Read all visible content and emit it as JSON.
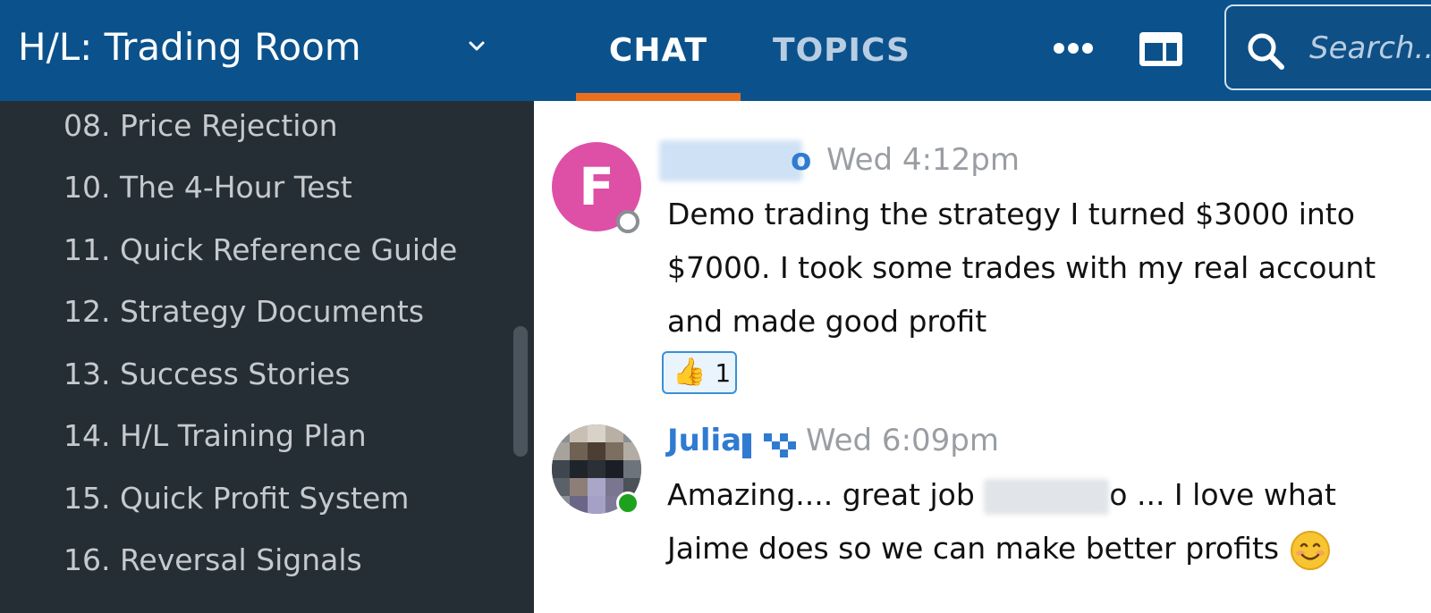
{
  "header": {
    "room_title": "H/L: Trading Room",
    "tabs": [
      {
        "label": "CHAT",
        "active": true
      },
      {
        "label": "TOPICS",
        "active": false
      }
    ],
    "search_placeholder": "Search...",
    "colors": {
      "background": "#0b528c",
      "active_underline": "#e8701f"
    },
    "icons": [
      "chevron-down-icon",
      "more-icon",
      "layout-icon",
      "search-icon"
    ]
  },
  "sidebar": {
    "items": [
      {
        "label": "08. Price Rejection"
      },
      {
        "label": "10. The 4-Hour Test"
      },
      {
        "label": "11. Quick Reference Guide"
      },
      {
        "label": "12. Strategy Documents"
      },
      {
        "label": "13. Success Stories"
      },
      {
        "label": "14. H/L Training Plan"
      },
      {
        "label": "15. Quick Profit System"
      },
      {
        "label": "16. Reversal Signals"
      }
    ]
  },
  "messages": [
    {
      "avatar_initial": "F",
      "avatar_color": "#de4fa6",
      "author_visible_suffix": "o",
      "time": "Wed 4:12pm",
      "text": "Demo trading the strategy I turned $3000 into $7000. I took some trades with my real account and made good profit",
      "reaction": {
        "emoji": "👍",
        "count": "1"
      }
    },
    {
      "author": "Julia",
      "time": "Wed 6:09pm",
      "text_before": "Amazing.... great job ",
      "text_after": "o ... I love what Jaime does so we can make better profits",
      "status": "online"
    }
  ]
}
